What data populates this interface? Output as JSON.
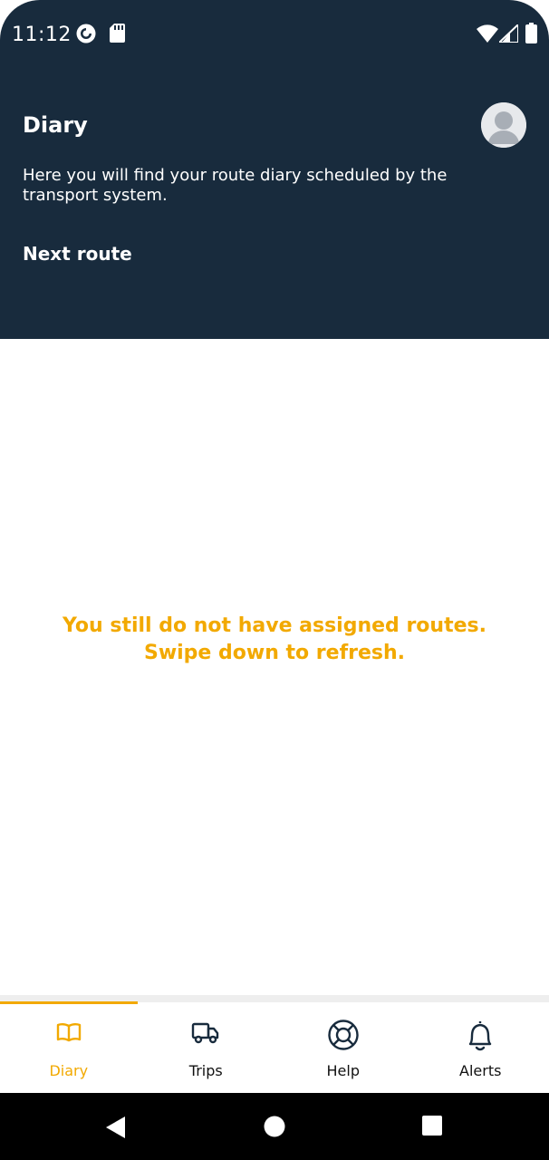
{
  "status_bar": {
    "time": "11:12",
    "icons": [
      "pocket-casts-icon",
      "sd-card-icon",
      "wifi-icon",
      "signal-icon",
      "battery-icon"
    ]
  },
  "header": {
    "title": "Diary",
    "description": "Here you will find your route diary scheduled by the transport system.",
    "section_label": "Next route",
    "background_color": "#182b3d"
  },
  "content": {
    "empty_line1": "You still do not have assigned routes.",
    "empty_line2": "Swipe down to refresh.",
    "accent_color": "#f2a900"
  },
  "bottom_nav": {
    "items": [
      {
        "label": "Diary",
        "icon": "book-icon",
        "active": true
      },
      {
        "label": "Trips",
        "icon": "truck-icon",
        "active": false
      },
      {
        "label": "Help",
        "icon": "lifebuoy-icon",
        "active": false
      },
      {
        "label": "Alerts",
        "icon": "bell-icon",
        "active": false
      }
    ]
  },
  "system_nav": {
    "buttons": [
      "back-icon",
      "home-icon",
      "recents-icon"
    ]
  }
}
